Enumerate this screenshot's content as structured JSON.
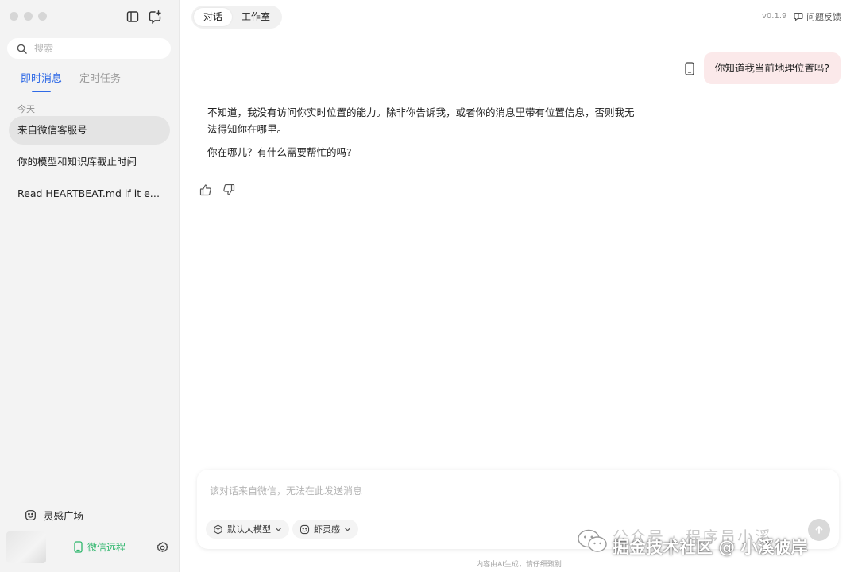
{
  "sidebar": {
    "search": {
      "placeholder": "搜索",
      "value": ""
    },
    "tabs": [
      {
        "label": "即时消息",
        "active": true
      },
      {
        "label": "定时任务",
        "active": false
      }
    ],
    "section_label": "今天",
    "conversations": [
      {
        "title": "来自微信客服号",
        "active": true
      },
      {
        "title": "你的模型和知识库截止时间",
        "active": false
      },
      {
        "title": "Read HEARTBEAT.md if it exi...",
        "active": false
      }
    ],
    "inspiration_label": "灵感广场",
    "wechat_remote_label": "微信远程"
  },
  "header": {
    "tabs": [
      {
        "label": "对话",
        "active": true
      },
      {
        "label": "工作室",
        "active": false
      }
    ],
    "version": "v0.1.9",
    "feedback_label": "问题反馈"
  },
  "chat": {
    "user_message": "你知道我当前地理位置吗?",
    "ai_paragraphs": [
      "不知道，我没有访问你实时位置的能力。除非你告诉我，或者你的消息里带有位置信息，否则我无法得知你在哪里。",
      "你在哪儿？有什么需要帮忙的吗?"
    ]
  },
  "composer": {
    "placeholder": "该对话来自微信，无法在此发送消息",
    "model_label": "默认大模型",
    "inspiration_chip_label": "虾灵感"
  },
  "disclaimer": "内容由AI生成，请仔细甄别",
  "watermark": {
    "top_text": "公众号 · 程序员小溪",
    "bottom_text": "掘金技术社区 @ 小溪彼岸"
  },
  "colors": {
    "accent": "#2f6ae6",
    "wechat_green": "#2cb66b",
    "user_bubble": "#fbe9ea",
    "sidebar_bg": "#f3f3f3"
  },
  "icons": {
    "search": "search-icon",
    "sidebar_toggle": "sidebar-toggle-icon",
    "new_chat": "new-chat-icon",
    "inspiration": "smile-icon",
    "phone": "phone-icon",
    "settings": "gear-icon",
    "feedback": "message-icon",
    "like": "thumbs-up-icon",
    "dislike": "thumbs-down-icon",
    "model": "cube-icon",
    "send": "arrow-up-icon"
  }
}
